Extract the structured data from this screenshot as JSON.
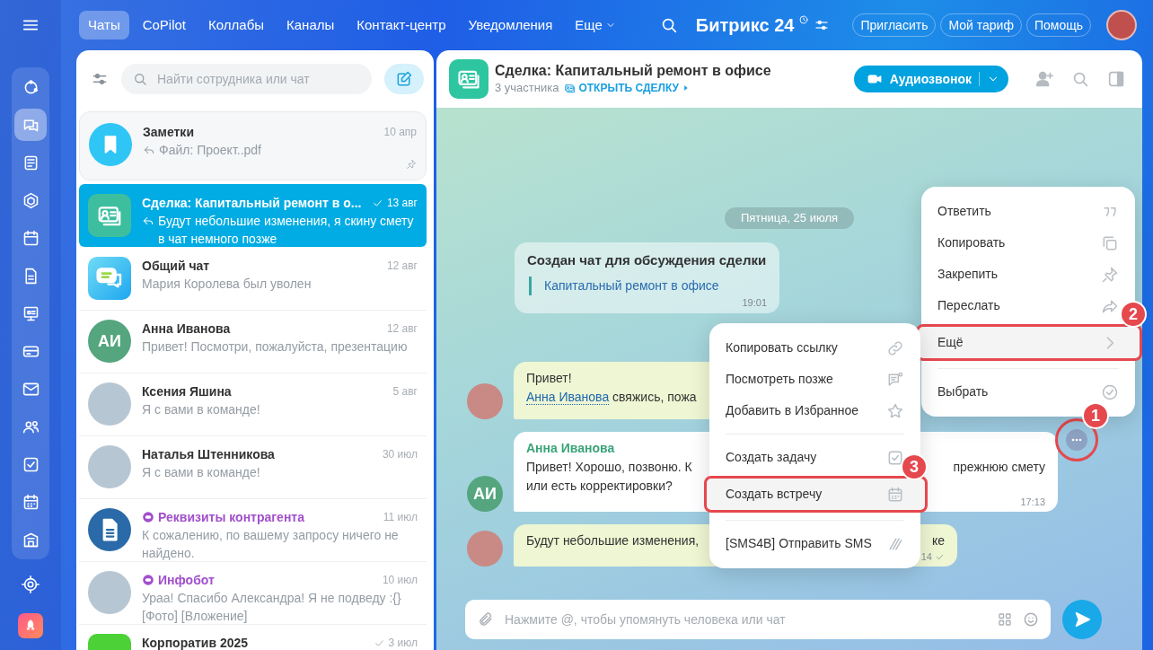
{
  "top_nav": {
    "tabs": [
      {
        "label": "Чаты",
        "selected": true
      },
      {
        "label": "CoPilot",
        "selected": false
      },
      {
        "label": "Коллабы",
        "selected": false
      },
      {
        "label": "Каналы",
        "selected": false
      },
      {
        "label": "Контакт-центр",
        "selected": false
      },
      {
        "label": "Уведомления",
        "selected": false
      }
    ],
    "more": "Еще",
    "logo": "Битрикс 24",
    "buttons": [
      "Пригласить",
      "Мой тариф",
      "Помощь"
    ]
  },
  "sidebar": {
    "items": [
      {
        "selected": false
      },
      {
        "selected": true
      },
      {
        "selected": false
      },
      {
        "selected": false
      },
      {
        "selected": false
      },
      {
        "selected": false
      },
      {
        "selected": false
      },
      {
        "selected": false
      },
      {
        "selected": false
      },
      {
        "selected": false
      },
      {
        "selected": false
      },
      {
        "selected": false
      },
      {
        "selected": false
      }
    ]
  },
  "chat_list": {
    "search": {
      "placeholder": "Найти сотрудника или чат"
    },
    "chats": [
      {
        "title": "Заметки",
        "preview": "Файл: Проект..pdf",
        "date": "10 апр",
        "avatar": {
          "kind": "bookmark"
        },
        "reply": true,
        "read": false,
        "pinned": true,
        "bot": false,
        "selected": false
      },
      {
        "title": "Сделка: Капитальный ремонт в о...",
        "preview": "Будут небольшие изменения, я скину смету в чат немного позже",
        "date": "13 авг",
        "avatar": {
          "kind": "deal"
        },
        "reply": true,
        "read": true,
        "pinned": false,
        "bot": false,
        "selected": true
      },
      {
        "title": "Общий чат",
        "preview": "Мария Королева был уволен",
        "date": "12 авг",
        "avatar": {
          "kind": "group"
        },
        "reply": false,
        "read": false,
        "pinned": false,
        "bot": false,
        "selected": false
      },
      {
        "title": "Анна Иванова",
        "preview": "Привет! Посмотри, пожалуйста, презентацию",
        "date": "12 авг",
        "avatar": {
          "kind": "initials",
          "text": "АИ"
        },
        "reply": false,
        "read": false,
        "pinned": false,
        "bot": false,
        "selected": false
      },
      {
        "title": "Ксения Яшина",
        "preview": "Я с вами в команде!",
        "date": "5 авг",
        "avatar": {
          "kind": "photo"
        },
        "reply": false,
        "read": false,
        "pinned": false,
        "bot": false,
        "selected": false
      },
      {
        "title": "Наталья Штенникова",
        "preview": "Я с вами в команде!",
        "date": "30 июл",
        "avatar": {
          "kind": "photo"
        },
        "reply": false,
        "read": false,
        "pinned": false,
        "bot": false,
        "selected": false
      },
      {
        "title": "Реквизиты контрагента",
        "preview": "К сожалению, по вашему запросу ничего не найдено.",
        "date": "11 июл",
        "avatar": {
          "kind": "document"
        },
        "reply": false,
        "read": false,
        "pinned": false,
        "bot": true,
        "selected": false
      },
      {
        "title": "Инфобот",
        "preview": "Ураа! Спасибо Александра! Я не подведу :{} [Фото] [Вложение]",
        "date": "10 июл",
        "avatar": {
          "kind": "photo"
        },
        "reply": false,
        "read": false,
        "pinned": false,
        "bot": true,
        "selected": false
      },
      {
        "title": "Корпоратив 2025",
        "date": "3 июл",
        "avatar": {
          "kind": "green"
        },
        "reply": false,
        "read": true,
        "pinned": false,
        "bot": false,
        "selected": false
      }
    ]
  },
  "chat": {
    "title": "Сделка: Капитальный ремонт в офисе",
    "participants": "3 участника",
    "deal_link": "ОТКРЫТЬ СДЕЛКУ",
    "call_button": "Аудиозвонок",
    "date_separator": "Пятница, 25 июля",
    "system_message": {
      "title": "Создан чат для обсуждения сделки",
      "link": "Капитальный ремонт в офисе",
      "time": "19:01"
    },
    "messages": [
      {
        "kind": "outgoing",
        "avatar": {
          "kind": "photo"
        },
        "lines": [
          {
            "text": "Привет!"
          },
          {
            "mention": "Анна Иванова",
            "text": "свяжись, пожа"
          }
        ],
        "read": false
      },
      {
        "kind": "incoming",
        "avatar": {
          "kind": "initials",
          "text": "АИ"
        },
        "author": "Анна Иванова",
        "lines": [
          {
            "text": "Привет! Хорошо, позвоню. К",
            "right": "прежнюю смету"
          },
          {
            "text": "или есть корректировки?"
          }
        ],
        "time": "17:13",
        "read": false
      },
      {
        "kind": "outgoing",
        "avatar": {
          "kind": "photo"
        },
        "lines": [
          {
            "text": "Будут небольшие изменения,",
            "right": "ке"
          }
        ],
        "time": "14",
        "read": true
      }
    ],
    "more_button": {
      "highlighted": true
    },
    "composer": {
      "placeholder": "Нажмите @, чтобы упомянуть человека или чат"
    }
  },
  "context_menu": {
    "items": [
      {
        "label": "Ответить",
        "separator_before": false,
        "highlighted": false
      },
      {
        "label": "Копировать",
        "separator_before": false,
        "highlighted": false
      },
      {
        "label": "Закрепить",
        "separator_before": false,
        "highlighted": false
      },
      {
        "label": "Переслать",
        "separator_before": false,
        "highlighted": false
      },
      {
        "label": "Ещё",
        "separator_before": false,
        "highlighted": true
      },
      {
        "label": "Выбрать",
        "separator_before": true,
        "highlighted": false
      }
    ]
  },
  "submenu": {
    "items": [
      {
        "label": "Копировать ссылку",
        "separator_before": false,
        "highlighted": false
      },
      {
        "label": "Посмотреть позже",
        "separator_before": false,
        "highlighted": false
      },
      {
        "label": "Добавить в Избранное",
        "separator_before": false,
        "highlighted": false
      },
      {
        "label": "Создать задачу",
        "separator_before": true,
        "highlighted": false
      },
      {
        "label": "Создать встречу",
        "separator_before": false,
        "highlighted": true
      },
      {
        "label": "[SMS4B] Отправить SMS",
        "separator_before": true,
        "highlighted": false
      }
    ]
  },
  "callouts": [
    {
      "number": "1"
    },
    {
      "number": "2"
    },
    {
      "number": "3"
    }
  ]
}
